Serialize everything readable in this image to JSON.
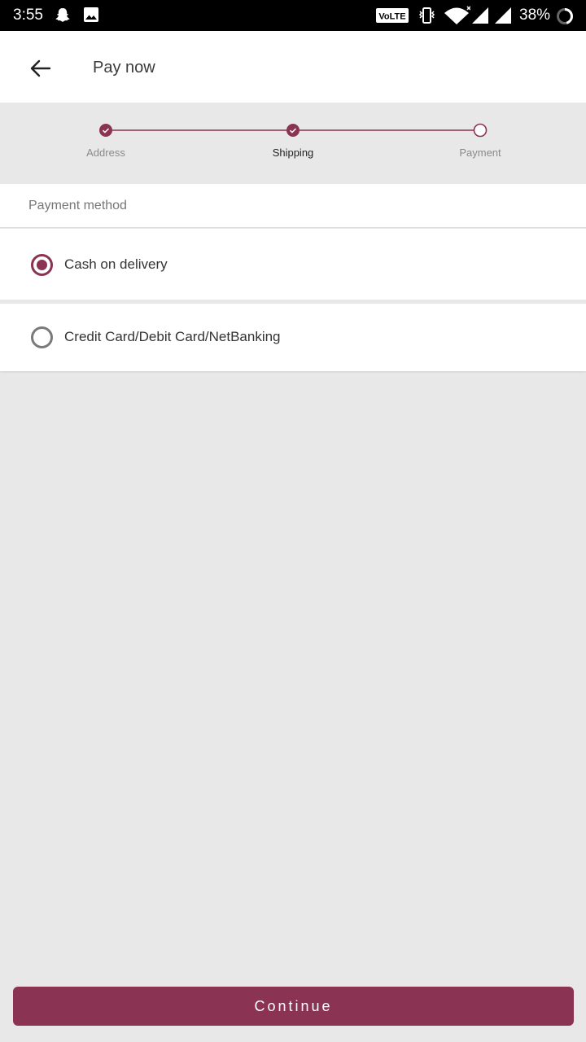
{
  "status_bar": {
    "time": "3:55",
    "volte": "VoLTE",
    "battery": "38%",
    "icons": [
      "snapchat-icon",
      "image-icon",
      "vibrate-icon",
      "wifi-icon",
      "signal-icon",
      "signal-icon",
      "battery-icon"
    ]
  },
  "app_bar": {
    "back_icon": "arrow-left-icon",
    "title": "Pay now"
  },
  "stepper": {
    "steps": [
      {
        "label": "Address",
        "state": "done"
      },
      {
        "label": "Shipping",
        "state": "done"
      },
      {
        "label": "Payment",
        "state": "current"
      }
    ]
  },
  "payment": {
    "header": "Payment method",
    "options": [
      {
        "label": "Cash on delivery",
        "selected": true
      },
      {
        "label": "Credit Card/Debit Card/NetBanking",
        "selected": false
      }
    ]
  },
  "actions": {
    "continue_label": "Continue"
  },
  "colors": {
    "accent": "#8b3352",
    "background": "#e8e8e8"
  }
}
